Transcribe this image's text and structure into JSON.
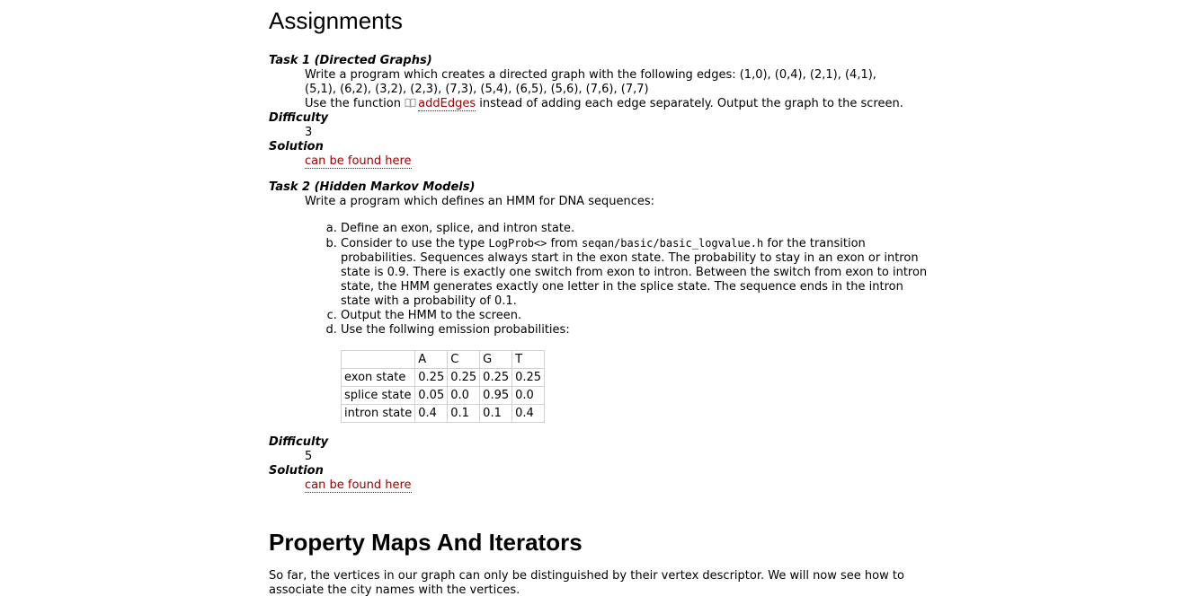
{
  "section_title": "Assignments",
  "task1": {
    "title": "Task 1 (Directed Graphs)",
    "desc_line1": "Write a program which creates a directed graph with the following edges: (1,0), (0,4), (2,1), (4,1),",
    "desc_line2": "(5,1), (6,2), (3,2), (2,3), (7,3), (5,4), (6,5), (5,6), (7,6), (7,7)",
    "desc_line3_pre": "Use the function",
    "link": "addEdges",
    "desc_line3_post": "instead of adding each edge separately. Output the graph to the screen.",
    "difficulty_label": "Difficulty",
    "difficulty": "3",
    "solution_label": "Solution",
    "solution_link": "can be found here"
  },
  "task2": {
    "title": "Task 2 (Hidden Markov Models)",
    "desc": "Write a program which defines an HMM for DNA sequences:",
    "item_a": "Define an exon, splice, and intron state.",
    "item_b_pre": "Consider to use the type",
    "item_b_code1": "LogProb<>",
    "item_b_mid": "from",
    "item_b_code2": "seqan/basic/basic_logvalue.h",
    "item_b_post": "for the transition probabilities. Sequences always start in the exon state. The probability to stay in an exon or intron state is 0.9. There is exactly one switch from exon to intron. Between the switch from exon to intron state, the HMM generates exactly one letter in the splice state. The sequence ends in the intron state with a probability of 0.1.",
    "item_c": "Output the HMM to the screen.",
    "item_d": "Use the follwing emission probabilities:",
    "table": {
      "headers": [
        "",
        "A",
        "C",
        "G",
        "T"
      ],
      "rows": [
        [
          "exon state",
          "0.25",
          "0.25",
          "0.25",
          "0.25"
        ],
        [
          "splice state",
          "0.05",
          "0.0",
          "0.95",
          "0.0"
        ],
        [
          "intron state",
          "0.4",
          "0.1",
          "0.1",
          "0.4"
        ]
      ]
    },
    "difficulty_label": "Difficulty",
    "difficulty": "5",
    "solution_label": "Solution",
    "solution_link": "can be found here"
  },
  "section2_title": "Property Maps And Iterators",
  "section2_para": "So far, the vertices in our graph can only be distinguished by their vertex descriptor. We will now see how to associate the city names with the vertices."
}
